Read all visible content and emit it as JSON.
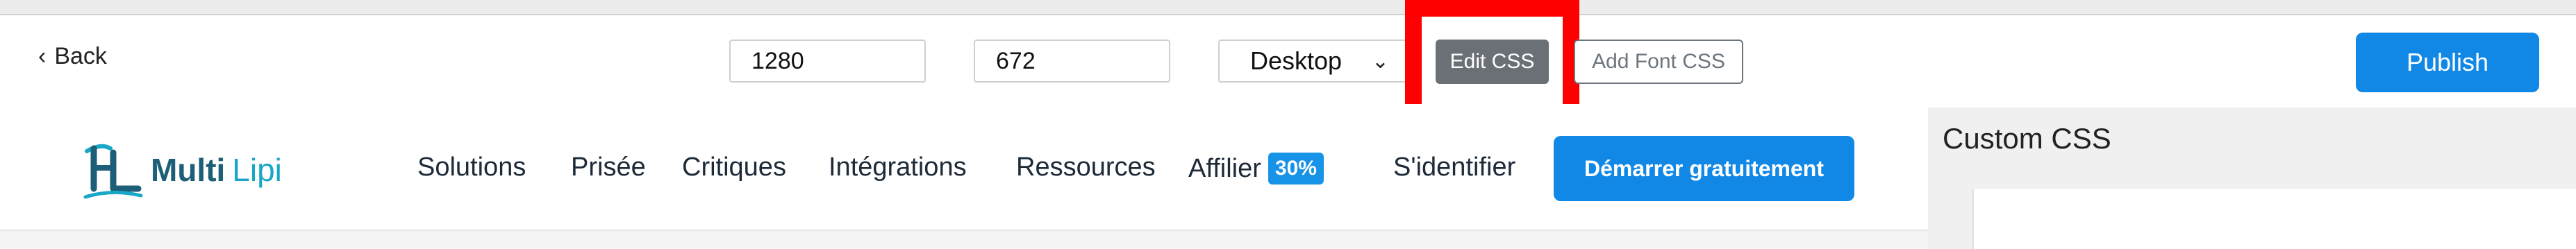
{
  "toolbar": {
    "back_label": "Back",
    "width_value": "1280",
    "height_value": "672",
    "device_selected": "Desktop",
    "edit_css_label": "Edit CSS",
    "add_font_css_label": "Add Font CSS",
    "publish_label": "Publish"
  },
  "site": {
    "logo_multi": "Multi",
    "logo_lipi": "Lipi",
    "nav": {
      "solutions": "Solutions",
      "prisee": "Prisée",
      "critiques": "Critiques",
      "integrations": "Intégrations",
      "ressources": "Ressources",
      "affilier": "Affilier",
      "affilier_badge": "30%",
      "login": "S'identifier"
    },
    "cta_label": "Démarrer gratuitement"
  },
  "panel": {
    "title": "Custom CSS"
  },
  "colors": {
    "accent_blue": "#1188e6",
    "highlight_red": "#ff0000",
    "edit_css_gray": "#6b7076"
  },
  "icons": {
    "back": "chevron-left-icon",
    "device_dropdown": "chevron-down-icon",
    "logo": "multilipi-logo"
  }
}
